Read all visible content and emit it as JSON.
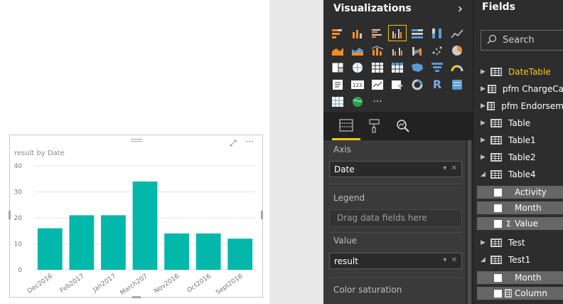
{
  "visual": {
    "title": "result by Date",
    "focus_icon": "⤢",
    "more_icon": "···"
  },
  "chart_data": {
    "type": "bar",
    "categories": [
      "Dec2016",
      "Feb2017",
      "Jan2017",
      "March207",
      "Nov2016",
      "Oct2016",
      "Sept2016"
    ],
    "values": [
      16,
      21,
      21,
      34,
      14,
      14,
      12
    ],
    "title": "result by Date",
    "ylim": [
      0,
      40
    ],
    "yticks": [
      0,
      10,
      20,
      30,
      40
    ],
    "grid": true,
    "color": "#01b8aa"
  },
  "visualizations": {
    "title": "Visualizations",
    "chevron": "›",
    "wells": {
      "axis_label": "Axis",
      "axis_value": "Date",
      "legend_label": "Legend",
      "legend_placeholder": "Drag data fields here",
      "value_label": "Value",
      "value_value": "result",
      "color_label": "Color saturation"
    }
  },
  "fields": {
    "title": "Fields",
    "search_placeholder": "Search",
    "tables": [
      {
        "name": "DateTable",
        "highlight": true,
        "expanded": false
      },
      {
        "name": "pfm ChargeCa",
        "expanded": false
      },
      {
        "name": "pfm Endorsem",
        "expanded": false
      },
      {
        "name": "Table",
        "expanded": false
      },
      {
        "name": "Table1",
        "expanded": false
      },
      {
        "name": "Table2",
        "expanded": false
      },
      {
        "name": "Table4",
        "expanded": true
      },
      {
        "name": "Test",
        "expanded": false
      },
      {
        "name": "Test1",
        "expanded": true
      }
    ],
    "table4_fields": [
      "Activity",
      "Month",
      "Value"
    ],
    "test1_fields": [
      "Month",
      "Column"
    ],
    "accent": "#f2c811"
  }
}
